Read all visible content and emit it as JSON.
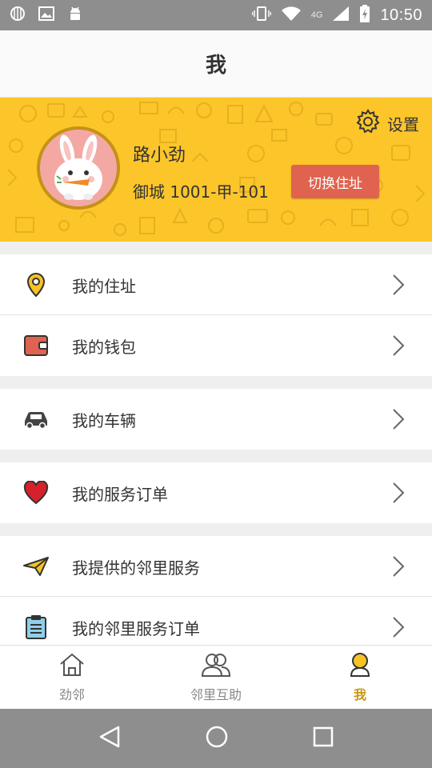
{
  "status_bar": {
    "time": "10:50",
    "network": "4G",
    "icons": [
      "signal-icon",
      "image-icon",
      "android-icon",
      "vibrate-icon",
      "wifi-icon",
      "cell-signal-icon",
      "battery-icon"
    ]
  },
  "header": {
    "title": "我"
  },
  "profile": {
    "name": "路小劲",
    "address": "御城 1001-甲-101",
    "settings_label": "设置",
    "switch_button_label": "切换住址",
    "banner_color": "#fcc52a"
  },
  "menu": {
    "items": [
      {
        "label": "我的住址",
        "icon": "location-pin-icon"
      },
      {
        "label": "我的钱包",
        "icon": "wallet-icon"
      },
      {
        "label": "我的车辆",
        "icon": "car-icon"
      },
      {
        "label": "我的服务订单",
        "icon": "heart-icon"
      },
      {
        "label": "我提供的邻里服务",
        "icon": "paper-plane-icon"
      },
      {
        "label": "我的邻里服务订单",
        "icon": "clipboard-icon"
      }
    ]
  },
  "tabs": [
    {
      "label": "劲邻",
      "icon": "home-icon",
      "active": false
    },
    {
      "label": "邻里互助",
      "icon": "people-icon",
      "active": false
    },
    {
      "label": "我",
      "icon": "user-icon",
      "active": true
    }
  ],
  "colors": {
    "accent": "#c8990f",
    "button": "#e06350",
    "banner": "#fcc52a"
  }
}
